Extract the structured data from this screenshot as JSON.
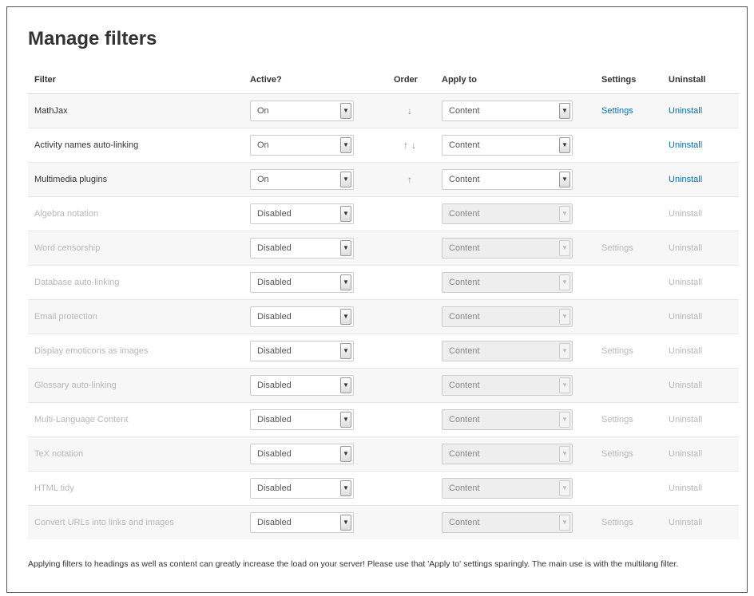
{
  "title": "Manage filters",
  "columns": {
    "filter": "Filter",
    "active": "Active?",
    "order": "Order",
    "apply": "Apply to",
    "settings": "Settings",
    "uninstall": "Uninstall"
  },
  "rows": [
    {
      "name": "MathJax",
      "active": "On",
      "order": "↓",
      "apply": "Content",
      "settings": "Settings",
      "uninstall": "Uninstall",
      "enabled": true
    },
    {
      "name": "Activity names auto-linking",
      "active": "On",
      "order": "↑↓",
      "apply": "Content",
      "settings": "",
      "uninstall": "Uninstall",
      "enabled": true
    },
    {
      "name": "Multimedia plugins",
      "active": "On",
      "order": "↑",
      "apply": "Content",
      "settings": "",
      "uninstall": "Uninstall",
      "enabled": true
    },
    {
      "name": "Algebra notation",
      "active": "Disabled",
      "order": "",
      "apply": "Content",
      "settings": "",
      "uninstall": "Uninstall",
      "enabled": false
    },
    {
      "name": "Word censorship",
      "active": "Disabled",
      "order": "",
      "apply": "Content",
      "settings": "Settings",
      "uninstall": "Uninstall",
      "enabled": false
    },
    {
      "name": "Database auto-linking",
      "active": "Disabled",
      "order": "",
      "apply": "Content",
      "settings": "",
      "uninstall": "Uninstall",
      "enabled": false
    },
    {
      "name": "Email protection",
      "active": "Disabled",
      "order": "",
      "apply": "Content",
      "settings": "",
      "uninstall": "Uninstall",
      "enabled": false
    },
    {
      "name": "Display emoticons as images",
      "active": "Disabled",
      "order": "",
      "apply": "Content",
      "settings": "Settings",
      "uninstall": "Uninstall",
      "enabled": false
    },
    {
      "name": "Glossary auto-linking",
      "active": "Disabled",
      "order": "",
      "apply": "Content",
      "settings": "",
      "uninstall": "Uninstall",
      "enabled": false
    },
    {
      "name": "Multi-Language Content",
      "active": "Disabled",
      "order": "",
      "apply": "Content",
      "settings": "Settings",
      "uninstall": "Uninstall",
      "enabled": false
    },
    {
      "name": "TeX notation",
      "active": "Disabled",
      "order": "",
      "apply": "Content",
      "settings": "Settings",
      "uninstall": "Uninstall",
      "enabled": false
    },
    {
      "name": "HTML tidy",
      "active": "Disabled",
      "order": "",
      "apply": "Content",
      "settings": "",
      "uninstall": "Uninstall",
      "enabled": false
    },
    {
      "name": "Convert URLs into links and images",
      "active": "Disabled",
      "order": "",
      "apply": "Content",
      "settings": "Settings",
      "uninstall": "Uninstall",
      "enabled": false
    }
  ],
  "note": "Applying filters to headings as well as content can greatly increase the load on your server! Please use that 'Apply to' settings sparingly. The main use is with the multilang filter.",
  "colors": {
    "link": "#0a6eb0",
    "disabled_text": "#b7b7b7"
  }
}
